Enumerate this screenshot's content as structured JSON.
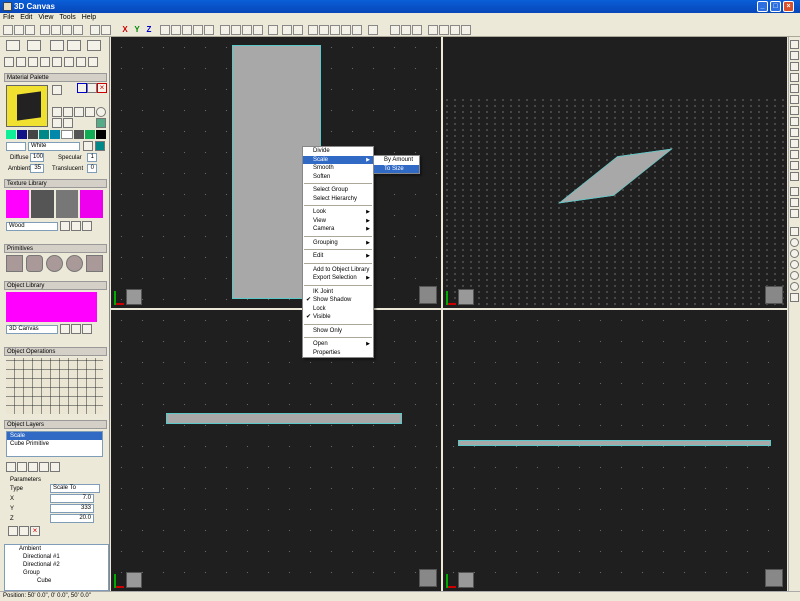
{
  "window": {
    "title": "3D Canvas"
  },
  "menubar": [
    "File",
    "Edit",
    "View",
    "Tools",
    "Help"
  ],
  "toolbar": {
    "axis_x": "X",
    "axis_y": "Y",
    "axis_z": "Z"
  },
  "material_palette": {
    "title": "Material Palette",
    "color_name": "White",
    "diffuse_label": "Diffuse",
    "diffuse_value": "100",
    "specular_label": "Specular",
    "specular_value": "1",
    "ambient_label": "Ambient",
    "ambient_value": "35",
    "translucent_label": "Translucent",
    "translucent_value": "0"
  },
  "texture_library": {
    "title": "Texture Library",
    "selected": "Wood"
  },
  "primitives": {
    "title": "Primitives"
  },
  "object_library": {
    "title": "Object Library",
    "selected": "3D Canvas"
  },
  "object_operations": {
    "title": "Object Operations"
  },
  "object_layers": {
    "title": "Object Layers",
    "items": [
      "Scale",
      "Cube Primitive"
    ]
  },
  "parameters": {
    "title": "Parameters",
    "type_label": "Type",
    "type_value": "Scale To",
    "x_label": "X",
    "x_value": "7.0",
    "y_label": "Y",
    "y_value": "333",
    "z_label": "Z",
    "z_value": "20.0"
  },
  "scene_tree": [
    "Ambient",
    "Directional #1",
    "Directional #2",
    "Group",
    "Cube"
  ],
  "context_menu": {
    "items": [
      {
        "label": "Divide"
      },
      {
        "label": "Scale",
        "submenu": true,
        "highlight": true
      },
      {
        "label": "Smooth"
      },
      {
        "label": "Soften"
      },
      {
        "sep": true
      },
      {
        "label": "Select Group"
      },
      {
        "label": "Select Hierarchy"
      },
      {
        "sep": true
      },
      {
        "label": "Look",
        "submenu": true
      },
      {
        "label": "View",
        "submenu": true
      },
      {
        "label": "Camera",
        "submenu": true
      },
      {
        "sep": true
      },
      {
        "label": "Grouping",
        "submenu": true
      },
      {
        "sep": true
      },
      {
        "label": "Edit",
        "submenu": true
      },
      {
        "sep": true
      },
      {
        "label": "Add to Object Library"
      },
      {
        "label": "Export Selection",
        "submenu": true
      },
      {
        "sep": true
      },
      {
        "label": "IK Joint"
      },
      {
        "label": "Show Shadow",
        "checked": true
      },
      {
        "label": "Lock"
      },
      {
        "label": "Visible",
        "checked": true
      },
      {
        "sep": true
      },
      {
        "label": "Show Only"
      },
      {
        "sep": true
      },
      {
        "label": "Open",
        "submenu": true
      },
      {
        "label": "Properties"
      }
    ],
    "submenu": [
      {
        "label": "By Amount"
      },
      {
        "label": "To Size",
        "highlight": true
      }
    ]
  },
  "status": {
    "text": "Position: 50' 0.0\", 0' 0.0\", 50' 0.0\""
  },
  "colors": {
    "viewport_bg": "#1f1f1f",
    "object_fill": "#a8a8a8",
    "object_edge": "#5cc8c8",
    "highlight": "#316ac5"
  }
}
